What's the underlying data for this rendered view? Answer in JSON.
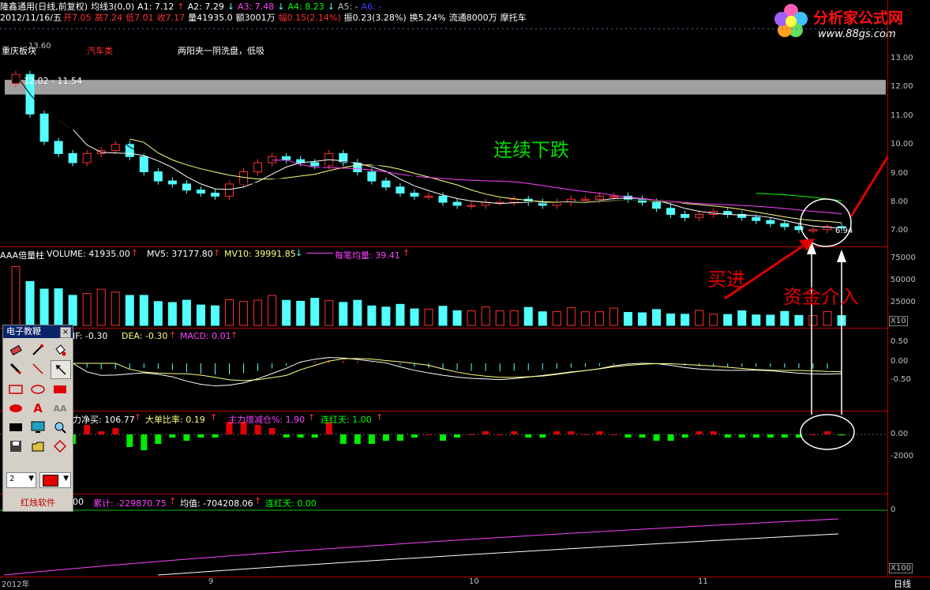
{
  "header": {
    "stock": "隆鑫通用(日线,前复权)",
    "ma_label": "均线3(0,0)",
    "a1": "A1: 7.12",
    "a2": "A2: 7.29",
    "a3": "A3: 7.48",
    "a4": "A4: 8.23",
    "a5": "A5: -",
    "a6": "A6: -",
    "date": "2012/11/16/五",
    "open": "开7.05",
    "high": "高7.24",
    "low": "低7.01",
    "close": "收7.17",
    "vol": "量41935.0",
    "amount": "额3001万",
    "change": "幅0.15(2.14%)",
    "amp": "振0.23(3.28%)",
    "turnover": "换5.24%",
    "float": "流通8000万",
    "industry": "摩托车"
  },
  "logo": {
    "name": "分析家公式网",
    "url": "www.88gs.com"
  },
  "main_chart": {
    "label_region": "重庆板块",
    "label_sector": "汽车类",
    "label_note": "两阳夹一阴洗盘，低吸",
    "high_mark": "13.60",
    "range_label": "12.02 - 11.54",
    "low_mark": "6.94",
    "annot_fall": "连续下跌",
    "annot_buy": "买进",
    "annot_fund": "资金介入",
    "y_ticks": [
      "13.00",
      "12.00",
      "11.00",
      "10.00",
      "9.00",
      "8.00",
      "7.00"
    ]
  },
  "volume_panel": {
    "title": "AAA倍量柱",
    "volume": "VOLUME: 41935.00",
    "mv5": "MV5: 37177.80",
    "mv10": "MV10: 39991.85",
    "avg_label": "每笔均量: 39.41",
    "y_ticks": [
      "75000",
      "50000",
      "25000"
    ],
    "unit": "X10"
  },
  "macd_panel": {
    "dif": "IF: -0.30",
    "dea": "DEA: -0.30",
    "macd": "MACD: 0.01",
    "y_ticks": [
      "0.50",
      "0.00",
      "-0.50"
    ]
  },
  "flow_panel": {
    "net": "力净买: 106.77",
    "ratio": "大单比率: 0.19",
    "main_change": "主力增减仓%: 1.90",
    "red_days": "连红天: 1.00",
    "y_ticks": [
      "0.00",
      "-2000"
    ]
  },
  "cum_panel": {
    "prefix": "00",
    "cum": "累计: -229870.75",
    "avg": "均值: -704208.06",
    "red_days": "连红天: 0.00",
    "y_ticks": [
      "0"
    ],
    "unit": "X100"
  },
  "x_axis": {
    "labels": [
      "2012年",
      "9",
      "10",
      "11"
    ],
    "period": "日线"
  },
  "tool_panel": {
    "title": "电子教鞭",
    "close": "×",
    "width_value": "2",
    "footer": "红烛软件",
    "tools": [
      "eraser-icon",
      "pen-icon",
      "fill-icon",
      "pencil-icon",
      "line-icon",
      "arrow-icon",
      "rectangle-icon",
      "ellipse-icon",
      "filled-rect-icon",
      "filled-ellipse-icon",
      "text-icon",
      "font-icon",
      "black-rect-icon",
      "screen-icon",
      "zoom-icon",
      "save-icon",
      "open-icon",
      "diamond-icon"
    ]
  },
  "colors": {
    "up": "#ff3030",
    "down": "#54ffff",
    "axis": "#b00000",
    "ma_white": "#ffffff",
    "ma_yellow": "#ffff80",
    "ma_magenta": "#ff40ff",
    "ma_green": "#00ff00",
    "annot_red": "#e00000",
    "annot_green": "#00dd00"
  },
  "chart_data": {
    "type": "candlestick",
    "price_ylim": [
      6.6,
      13.4
    ],
    "closes": [
      12.2,
      10.9,
      10.0,
      9.6,
      9.3,
      9.6,
      9.7,
      9.9,
      9.5,
      9.0,
      8.7,
      8.6,
      8.4,
      8.3,
      8.2,
      8.6,
      9.0,
      9.3,
      9.5,
      9.4,
      9.3,
      9.2,
      9.6,
      9.3,
      9.0,
      8.7,
      8.5,
      8.3,
      8.2,
      8.2,
      8.0,
      7.9,
      7.9,
      8.0,
      8.0,
      8.1,
      8.0,
      7.9,
      8.0,
      8.1,
      8.1,
      8.2,
      8.2,
      8.1,
      8.0,
      7.8,
      7.6,
      7.5,
      7.6,
      7.7,
      7.6,
      7.5,
      7.4,
      7.3,
      7.2,
      7.1,
      7.1,
      7.2,
      7.17
    ]
  }
}
